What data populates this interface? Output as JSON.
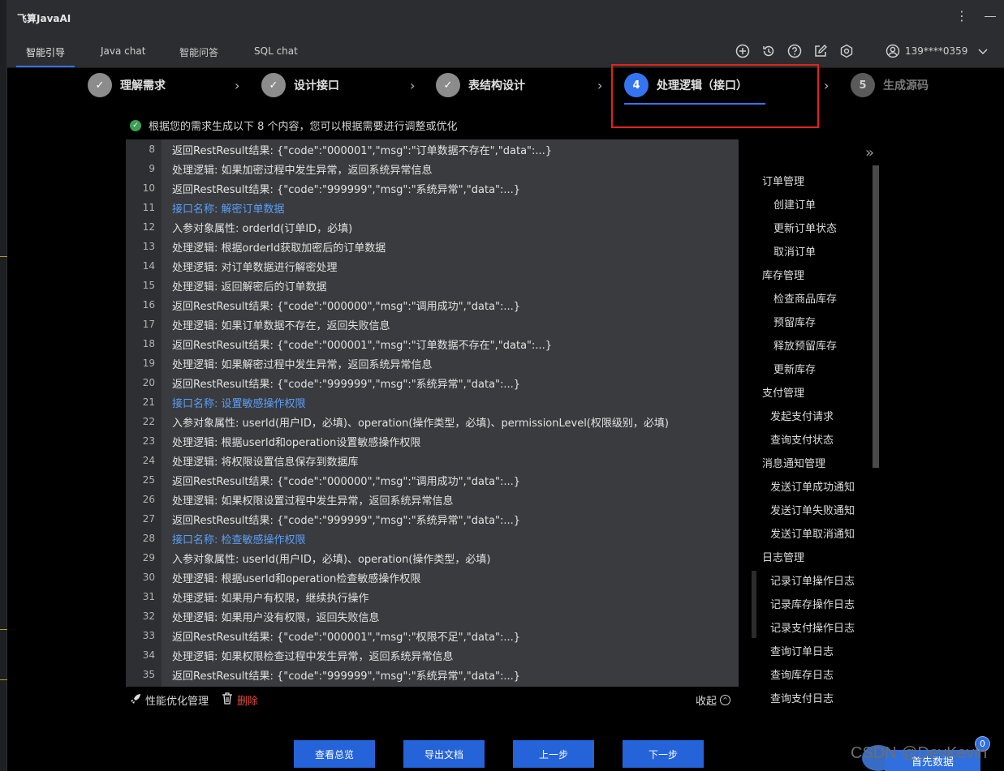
{
  "app": {
    "title": "飞算JavaAI"
  },
  "tabs": [
    {
      "label": "智能引导",
      "active": true
    },
    {
      "label": "Java chat",
      "active": false
    },
    {
      "label": "智能问答",
      "active": false
    },
    {
      "label": "SQL chat",
      "active": false
    }
  ],
  "toolbar_icons": [
    "plus-circle-icon",
    "history-icon",
    "help-icon",
    "edit-icon",
    "settings-icon"
  ],
  "user": {
    "phone": "139****0359"
  },
  "steps": [
    {
      "label": "理解需求",
      "state": "done",
      "mark": "✓"
    },
    {
      "label": "设计接口",
      "state": "done",
      "mark": "✓"
    },
    {
      "label": "表结构设计",
      "state": "done",
      "mark": "✓"
    },
    {
      "label": "处理逻辑（接口）",
      "state": "current",
      "mark": "4"
    },
    {
      "label": "生成源码",
      "state": "pending",
      "mark": "5"
    }
  ],
  "notice": "根据您的需求生成以下 8 个内容，您可以根据需要进行调整或优化",
  "code_lines": [
    {
      "n": "8",
      "text": "返回RestResult结果: {\"code\":\"000001\",\"msg\":\"订单数据不存在\",\"data\":...}",
      "kind": "plain"
    },
    {
      "n": "9",
      "text": "处理逻辑: 如果加密过程中发生异常，返回系统异常信息",
      "kind": "plain"
    },
    {
      "n": "10",
      "text": "返回RestResult结果: {\"code\":\"999999\",\"msg\":\"系统异常\",\"data\":...}",
      "kind": "plain"
    },
    {
      "n": "11",
      "text": "接口名称: 解密订单数据",
      "kind": "api"
    },
    {
      "n": "12",
      "text": "入参对象属性: orderId(订单ID，必填)",
      "kind": "plain"
    },
    {
      "n": "13",
      "text": "处理逻辑: 根据orderId获取加密后的订单数据",
      "kind": "plain"
    },
    {
      "n": "14",
      "text": "处理逻辑: 对订单数据进行解密处理",
      "kind": "plain"
    },
    {
      "n": "15",
      "text": "处理逻辑: 返回解密后的订单数据",
      "kind": "plain"
    },
    {
      "n": "16",
      "text": "返回RestResult结果: {\"code\":\"000000\",\"msg\":\"调用成功\",\"data\":...}",
      "kind": "plain"
    },
    {
      "n": "17",
      "text": "处理逻辑: 如果订单数据不存在，返回失败信息",
      "kind": "plain"
    },
    {
      "n": "18",
      "text": "返回RestResult结果: {\"code\":\"000001\",\"msg\":\"订单数据不存在\",\"data\":...}",
      "kind": "plain"
    },
    {
      "n": "19",
      "text": "处理逻辑: 如果解密过程中发生异常，返回系统异常信息",
      "kind": "plain"
    },
    {
      "n": "20",
      "text": "返回RestResult结果: {\"code\":\"999999\",\"msg\":\"系统异常\",\"data\":...}",
      "kind": "plain"
    },
    {
      "n": "21",
      "text": "接口名称: 设置敏感操作权限",
      "kind": "api"
    },
    {
      "n": "22",
      "text": "入参对象属性: userId(用户ID，必填)、operation(操作类型，必填)、permissionLevel(权限级别，必填)",
      "kind": "plain"
    },
    {
      "n": "23",
      "text": "处理逻辑: 根据userId和operation设置敏感操作权限",
      "kind": "plain"
    },
    {
      "n": "24",
      "text": "处理逻辑: 将权限设置信息保存到数据库",
      "kind": "plain"
    },
    {
      "n": "25",
      "text": "返回RestResult结果: {\"code\":\"000000\",\"msg\":\"调用成功\",\"data\":...}",
      "kind": "plain"
    },
    {
      "n": "26",
      "text": "处理逻辑: 如果权限设置过程中发生异常，返回系统异常信息",
      "kind": "plain"
    },
    {
      "n": "27",
      "text": "返回RestResult结果: {\"code\":\"999999\",\"msg\":\"系统异常\",\"data\":...}",
      "kind": "plain"
    },
    {
      "n": "28",
      "text": "接口名称: 检查敏感操作权限",
      "kind": "api"
    },
    {
      "n": "29",
      "text": "入参对象属性: userId(用户ID，必填)、operation(操作类型，必填)",
      "kind": "plain"
    },
    {
      "n": "30",
      "text": "处理逻辑: 根据userId和operation检查敏感操作权限",
      "kind": "plain"
    },
    {
      "n": "31",
      "text": "处理逻辑: 如果用户有权限，继续执行操作",
      "kind": "plain"
    },
    {
      "n": "32",
      "text": "处理逻辑: 如果用户没有权限，返回失败信息",
      "kind": "plain"
    },
    {
      "n": "33",
      "text": "返回RestResult结果: {\"code\":\"000001\",\"msg\":\"权限不足\",\"data\":...}",
      "kind": "plain"
    },
    {
      "n": "34",
      "text": "处理逻辑: 如果权限检查过程中发生异常，返回系统异常信息",
      "kind": "plain"
    },
    {
      "n": "35",
      "text": "返回RestResult结果: {\"code\":\"999999\",\"msg\":\"系统异常\",\"data\":...}",
      "kind": "plain"
    }
  ],
  "footer": {
    "perf": "性能优化管理",
    "delete": "删除",
    "collapse": "收起"
  },
  "toc": [
    {
      "label": "订单管理",
      "level": "group"
    },
    {
      "label": "创建订单",
      "level": "child"
    },
    {
      "label": "更新订单状态",
      "level": "child"
    },
    {
      "label": "取消订单",
      "level": "child"
    },
    {
      "label": "库存管理",
      "level": "group"
    },
    {
      "label": "检查商品库存",
      "level": "child"
    },
    {
      "label": "预留库存",
      "level": "child"
    },
    {
      "label": "释放预留库存",
      "level": "child"
    },
    {
      "label": "更新库存",
      "level": "child"
    },
    {
      "label": "支付管理",
      "level": "group"
    },
    {
      "label": "发起支付请求",
      "level": "child2"
    },
    {
      "label": "查询支付状态",
      "level": "child2"
    },
    {
      "label": "消息通知管理",
      "level": "group"
    },
    {
      "label": "发送订单成功通知",
      "level": "child2"
    },
    {
      "label": "发送订单失败通知",
      "level": "child2"
    },
    {
      "label": "发送订单取消通知",
      "level": "child2"
    },
    {
      "label": "日志管理",
      "level": "group"
    },
    {
      "label": "记录订单操作日志",
      "level": "child2"
    },
    {
      "label": "记录库存操作日志",
      "level": "child2"
    },
    {
      "label": "记录支付操作日志",
      "level": "child2"
    },
    {
      "label": "查询订单日志",
      "level": "child2"
    },
    {
      "label": "查询库存日志",
      "level": "child2"
    },
    {
      "label": "查询支付日志",
      "level": "child2"
    }
  ],
  "buttons": {
    "overview": "查看总览",
    "export": "导出文档",
    "prev": "上一步",
    "next": "下一步"
  },
  "watermark": "CSDN @DevKevin",
  "first_badge": "首先数据",
  "count_badge": "0",
  "colors": {
    "accent": "#3574f0",
    "highlight": "#e2231a",
    "api_text": "#5b9ff7",
    "delete": "#e04a3f"
  }
}
